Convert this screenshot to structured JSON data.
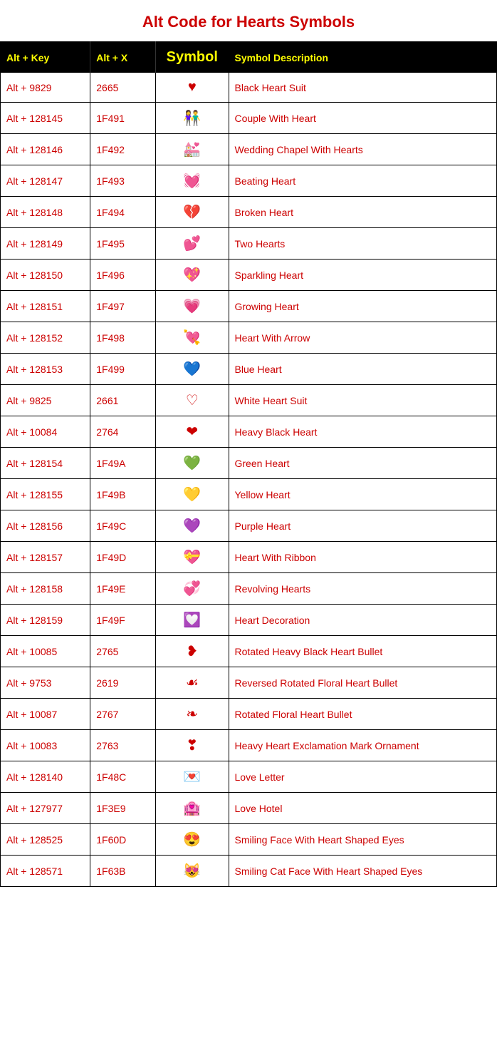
{
  "title": "Alt Code for Hearts Symbols",
  "header": {
    "col1": "Alt + Key",
    "col2": "Alt + X",
    "col3": "Symbol",
    "col4": "Symbol Description"
  },
  "rows": [
    {
      "altkey": "Alt + 9829",
      "altx": "2665",
      "symbol": "♥",
      "desc": "Black Heart Suit"
    },
    {
      "altkey": "Alt + 128145",
      "altx": "1F491",
      "symbol": "👫",
      "desc": "Couple With Heart"
    },
    {
      "altkey": "Alt + 128146",
      "altx": "1F492",
      "symbol": "💒",
      "desc": "Wedding Chapel With Hearts"
    },
    {
      "altkey": "Alt + 128147",
      "altx": "1F493",
      "symbol": "💓",
      "desc": "Beating Heart"
    },
    {
      "altkey": "Alt + 128148",
      "altx": "1F494",
      "symbol": "💔",
      "desc": "Broken Heart"
    },
    {
      "altkey": "Alt + 128149",
      "altx": "1F495",
      "symbol": "💕",
      "desc": "Two Hearts"
    },
    {
      "altkey": "Alt + 128150",
      "altx": "1F496",
      "symbol": "💖",
      "desc": "Sparkling Heart"
    },
    {
      "altkey": "Alt + 128151",
      "altx": "1F497",
      "symbol": "💗",
      "desc": "Growing Heart"
    },
    {
      "altkey": "Alt + 128152",
      "altx": "1F498",
      "symbol": "💘",
      "desc": "Heart With Arrow"
    },
    {
      "altkey": "Alt + 128153",
      "altx": "1F499",
      "symbol": "💙",
      "desc": "Blue Heart"
    },
    {
      "altkey": "Alt + 9825",
      "altx": "2661",
      "symbol": "♡",
      "desc": "White Heart Suit"
    },
    {
      "altkey": "Alt + 10084",
      "altx": "2764",
      "symbol": "❤",
      "desc": "Heavy Black Heart"
    },
    {
      "altkey": "Alt + 128154",
      "altx": "1F49A",
      "symbol": "💚",
      "desc": "Green Heart"
    },
    {
      "altkey": "Alt + 128155",
      "altx": "1F49B",
      "symbol": "💛",
      "desc": "Yellow Heart"
    },
    {
      "altkey": "Alt + 128156",
      "altx": "1F49C",
      "symbol": "💜",
      "desc": "Purple Heart"
    },
    {
      "altkey": "Alt + 128157",
      "altx": "1F49D",
      "symbol": "💝",
      "desc": "Heart With Ribbon"
    },
    {
      "altkey": "Alt + 128158",
      "altx": "1F49E",
      "symbol": "💞",
      "desc": "Revolving Hearts"
    },
    {
      "altkey": "Alt + 128159",
      "altx": "1F49F",
      "symbol": "💟",
      "desc": "Heart Decoration"
    },
    {
      "altkey": "Alt + 10085",
      "altx": "2765",
      "symbol": "❥",
      "desc": "Rotated Heavy Black Heart Bullet"
    },
    {
      "altkey": "Alt + 9753",
      "altx": "2619",
      "symbol": "☙",
      "desc": "Reversed Rotated Floral Heart Bullet"
    },
    {
      "altkey": "Alt + 10087",
      "altx": "2767",
      "symbol": "❧",
      "desc": "Rotated Floral Heart Bullet"
    },
    {
      "altkey": "Alt + 10083",
      "altx": "2763",
      "symbol": "❣",
      "desc": "Heavy Heart Exclamation Mark Ornament"
    },
    {
      "altkey": "Alt + 128140",
      "altx": "1F48C",
      "symbol": "💌",
      "desc": "Love Letter"
    },
    {
      "altkey": "Alt + 127977",
      "altx": "1F3E9",
      "symbol": "🏩",
      "desc": "Love Hotel"
    },
    {
      "altkey": "Alt + 128525",
      "altx": "1F60D",
      "symbol": "😍",
      "desc": "Smiling Face With Heart Shaped Eyes"
    },
    {
      "altkey": "Alt + 128571",
      "altx": "1F63B",
      "symbol": "😻",
      "desc": "Smiling Cat Face With Heart Shaped Eyes"
    }
  ]
}
